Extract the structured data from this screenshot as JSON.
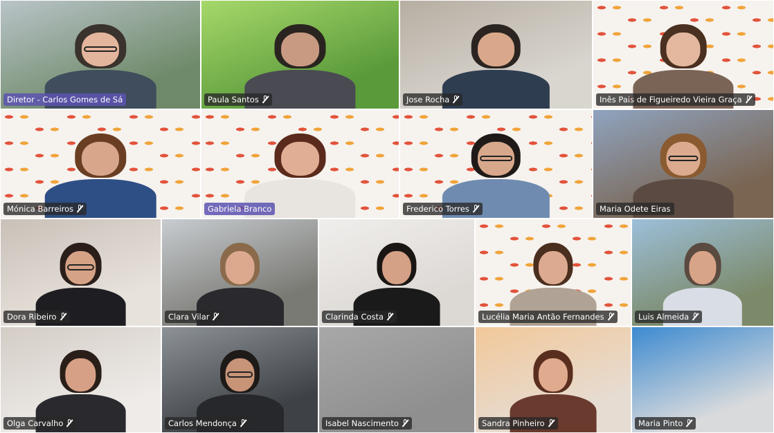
{
  "participants": [
    {
      "name": "Diretor - Carlos Gomes de Sá",
      "muted": false,
      "highlight": true,
      "bg": "#6f8a6a",
      "bg2": "#b9c4c8",
      "skin": "#e3b59c",
      "hair": "#3a322c",
      "shirt": "#3f4d5c",
      "glasses": true
    },
    {
      "name": "Paula Santos",
      "muted": true,
      "highlight": false,
      "bg": "#5a9a3a",
      "bg2": "#a6d86a",
      "skin": "#c89a82",
      "hair": "#2a2420",
      "shirt": "#4a4a52",
      "glasses": false
    },
    {
      "name": "Jose Rocha",
      "muted": true,
      "highlight": false,
      "bg": "#d9d6d0",
      "bg2": "#b7aea2",
      "skin": "#d9a88a",
      "hair": "#2b2420",
      "shirt": "#2f3d50",
      "glasses": false
    },
    {
      "name": "Inês Pais de Figueiredo Vieira Graça",
      "muted": true,
      "highlight": false,
      "bg": "logo",
      "bg2": "",
      "skin": "#e3b89e",
      "hair": "#4a3020",
      "shirt": "#7a6456",
      "glasses": false
    },
    {
      "name": "Mónica Barreiros",
      "muted": true,
      "highlight": false,
      "bg": "logo",
      "bg2": "",
      "skin": "#d8a68a",
      "hair": "#6a3e22",
      "shirt": "#2e4f86",
      "glasses": false
    },
    {
      "name": "Gabriela Branco",
      "muted": false,
      "highlight": true,
      "bg": "logo",
      "bg2": "",
      "skin": "#e0ae94",
      "hair": "#5a2a1c",
      "shirt": "#e8e4e0",
      "glasses": false
    },
    {
      "name": "Frederico Torres",
      "muted": true,
      "highlight": false,
      "bg": "logo",
      "bg2": "",
      "skin": "#d8a88c",
      "hair": "#1f1a17",
      "shirt": "#6f8cb0",
      "glasses": true
    },
    {
      "name": "Maria Odete Eiras",
      "muted": false,
      "highlight": false,
      "bg": "#7a6552",
      "bg2": "#8fa4c0",
      "skin": "#dcaa8e",
      "hair": "#8a5a30",
      "shirt": "#5a4a42",
      "glasses": true
    },
    {
      "name": "Dora Ribeiro",
      "muted": true,
      "highlight": false,
      "bg": "#e8e2dc",
      "bg2": "#c9c1b8",
      "skin": "#d6a286",
      "hair": "#2a1e1a",
      "shirt": "#1e1e22",
      "glasses": true
    },
    {
      "name": "Clara Vilar",
      "muted": true,
      "highlight": false,
      "bg": "#7a7a74",
      "bg2": "#c8ccd0",
      "skin": "#dca98e",
      "hair": "#8a6a4a",
      "shirt": "#2a2a2e",
      "glasses": false
    },
    {
      "name": "Clarinda Costa",
      "muted": true,
      "highlight": false,
      "bg": "#dcd8d4",
      "bg2": "#f0eeec",
      "skin": "#d4a086",
      "hair": "#1a1614",
      "shirt": "#1a1a1a",
      "glasses": false
    },
    {
      "name": "Lucélia Maria Antão Fernandes",
      "muted": true,
      "highlight": false,
      "bg": "logo",
      "bg2": "",
      "skin": "#dcaa90",
      "hair": "#4a2e1e",
      "shirt": "#b0a294",
      "glasses": false
    },
    {
      "name": "Luis Almeida",
      "muted": true,
      "highlight": false,
      "bg": "#7c8a6a",
      "bg2": "#9cbfda",
      "skin": "#d8a488",
      "hair": "#5a4a40",
      "shirt": "#d9dde6",
      "glasses": false
    },
    {
      "name": "Olga Carvalho",
      "muted": true,
      "highlight": false,
      "bg": "#eeebe8",
      "bg2": "#d4cdc6",
      "skin": "#d6a086",
      "hair": "#2a1e18",
      "shirt": "#2a2a2e",
      "glasses": false
    },
    {
      "name": "Carlos Mendonça",
      "muted": true,
      "highlight": false,
      "bg": "#3e4246",
      "bg2": "#8d9296",
      "skin": "#c89478",
      "hair": "#1e1a18",
      "shirt": "#26282c",
      "glasses": true
    },
    {
      "name": "Isabel Nascimento",
      "muted": true,
      "highlight": false,
      "bg": "#8f8f8f",
      "bg2": "#a8a8a8",
      "skin": "",
      "hair": "",
      "shirt": "",
      "glasses": false
    },
    {
      "name": "Sandra Pinheiro",
      "muted": true,
      "highlight": false,
      "bg": "#e6dcd2",
      "bg2": "#f2c89a",
      "skin": "#e0aa8e",
      "hair": "#5a2e1e",
      "shirt": "#6a3a2e",
      "glasses": false
    },
    {
      "name": "Maria Pinto",
      "muted": true,
      "highlight": false,
      "bg": "#d8dadc",
      "bg2": "#3c8ad0",
      "skin": "",
      "hair": "",
      "shirt": "",
      "glasses": false
    }
  ]
}
